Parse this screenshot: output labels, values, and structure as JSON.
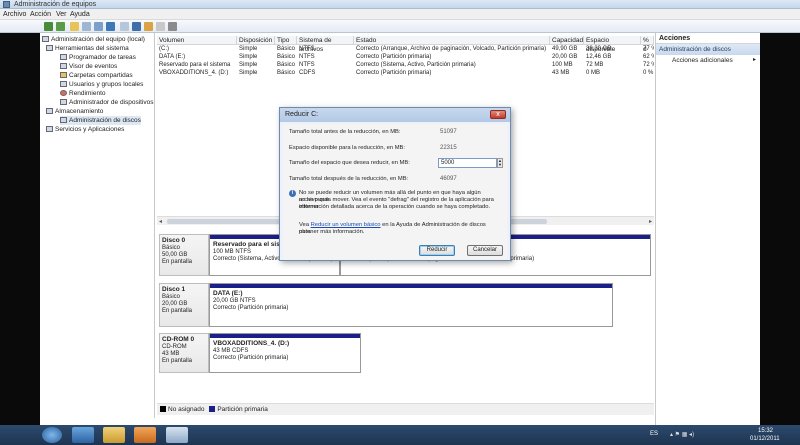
{
  "window": {
    "title": "Administración de equipos"
  },
  "menu": [
    "Archivo",
    "Acción",
    "Ver",
    "Ayuda"
  ],
  "tree": [
    {
      "label": "Administración del equipo (local)",
      "level": 0
    },
    {
      "label": "Herramientas del sistema",
      "level": 1
    },
    {
      "label": "Programador de tareas",
      "level": 2
    },
    {
      "label": "Visor de eventos",
      "level": 2
    },
    {
      "label": "Carpetas compartidas",
      "level": 2
    },
    {
      "label": "Usuarios y grupos locales",
      "level": 2
    },
    {
      "label": "Rendimiento",
      "level": 2
    },
    {
      "label": "Administrador de dispositivos",
      "level": 2
    },
    {
      "label": "Almacenamiento",
      "level": 1
    },
    {
      "label": "Administración de discos",
      "level": 2
    },
    {
      "label": "Servicios y Aplicaciones",
      "level": 1
    }
  ],
  "volume_table": {
    "headers": [
      "Volumen",
      "Disposición",
      "Tipo",
      "Sistema de archivos",
      "Estado",
      "Capacidad",
      "Espacio disponible",
      "% d"
    ],
    "rows": [
      [
        "(C:)",
        "Simple",
        "Básico",
        "NTFS",
        "Correcto (Arranque, Archivo de paginación, Volcado, Partición primaria)",
        "49,90 GB",
        "38,30 GB",
        "77 %"
      ],
      [
        "DATA (E:)",
        "Simple",
        "Básico",
        "NTFS",
        "Correcto (Partición primaria)",
        "20,00 GB",
        "12,46 GB",
        "62 %"
      ],
      [
        "Reservado para el sistema",
        "Simple",
        "Básico",
        "NTFS",
        "Correcto (Sistema, Activo, Partición primaria)",
        "100 MB",
        "72 MB",
        "72 %"
      ],
      [
        "VBOXADDITIONS_4. (D:)",
        "Simple",
        "Básico",
        "CDFS",
        "Correcto (Partición primaria)",
        "43 MB",
        "0 MB",
        "0 %"
      ]
    ]
  },
  "disks": [
    {
      "name": "Disco 0",
      "type": "Básico",
      "size": "50,00 GB",
      "state": "En pantalla",
      "partitions": [
        {
          "name": "Reservado para el sistem",
          "detail": "100 MB NTFS",
          "status": "Correcto (Sistema, Activo, Partición primaria)"
        },
        {
          "name": "",
          "detail": "",
          "status": "Correcto (Arranque, Archivo de paginación, Volcado, Partición primaria)"
        }
      ]
    },
    {
      "name": "Disco 1",
      "type": "Básico",
      "size": "20,00 GB",
      "state": "En pantalla",
      "partitions": [
        {
          "name": "DATA (E:)",
          "detail": "20,00 GB NTFS",
          "status": "Correcto (Partición primaria)"
        }
      ]
    },
    {
      "name": "CD-ROM 0",
      "type": "CD-ROM",
      "size": "43 MB",
      "state": "En pantalla",
      "partitions": [
        {
          "name": "VBOXADDITIONS_4. (D:)",
          "detail": "43 MB CDFS",
          "status": "Correcto (Partición primaria)"
        }
      ]
    }
  ],
  "legend": [
    {
      "label": "No asignado",
      "color": "#000000"
    },
    {
      "label": "Partición primaria",
      "color": "#1b1f8a"
    }
  ],
  "actions": {
    "header": "Acciones",
    "section": "Administración de discos",
    "item": "Acciones adicionales"
  },
  "dialog": {
    "title": "Reducir C:",
    "close": "x",
    "total_before_label": "Tamaño total antes de la reducción, en MB:",
    "total_before_value": "51097",
    "available_label": "Espacio disponible para la reducción, en MB:",
    "available_value": "22315",
    "shrink_label": "Tamaño del espacio que desea reducir, en MB:",
    "shrink_value": "5000",
    "total_after_label": "Tamaño total después de la reducción, en MB:",
    "total_after_value": "46097",
    "note_1": "No se puede reducir un volumen más allá del punto en que haya algún archivo que",
    "note_2": "no se pueda mover. Vea el evento \"defrag\" del registro de la aplicación para obtener",
    "note_3": "información detallada acerca de la operación cuando se haya completado.",
    "help_prefix": "Vea ",
    "help_link": "Reducir un volumen básico",
    "help_suffix": " en la Ayuda de Administración de discos para",
    "help_line2": "obtener más información.",
    "ok": "Reducir",
    "cancel": "Cancelar"
  },
  "tray": {
    "lang": "ES",
    "time": "15:32",
    "date": "01/12/2011"
  }
}
